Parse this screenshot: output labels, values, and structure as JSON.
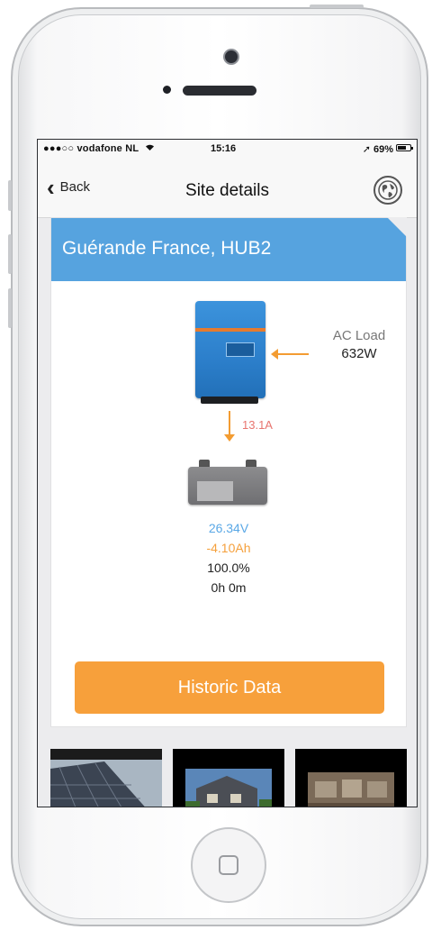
{
  "status_bar": {
    "carrier": "●●●○○ vodafone NL",
    "time": "15:16",
    "battery_text": "69%",
    "battery_level": 0.69
  },
  "nav": {
    "back_label": "Back",
    "title": "Site details",
    "globe_icon": "globe-icon"
  },
  "site": {
    "name": "Guérande France, HUB2"
  },
  "system": {
    "ac_load_label": "AC Load",
    "ac_load_value": "632W",
    "current": "13.1A",
    "voltage": "26.34V",
    "amp_hours": "-4.10Ah",
    "state_of_charge": "100.0%",
    "time_to_go": "0h 0m"
  },
  "actions": {
    "historic_label": "Historic Data"
  },
  "colors": {
    "header_blue": "#56a3df",
    "accent_orange": "#f7a03b",
    "current_red": "#e8756f",
    "voltage_blue": "#5aa8e6"
  }
}
